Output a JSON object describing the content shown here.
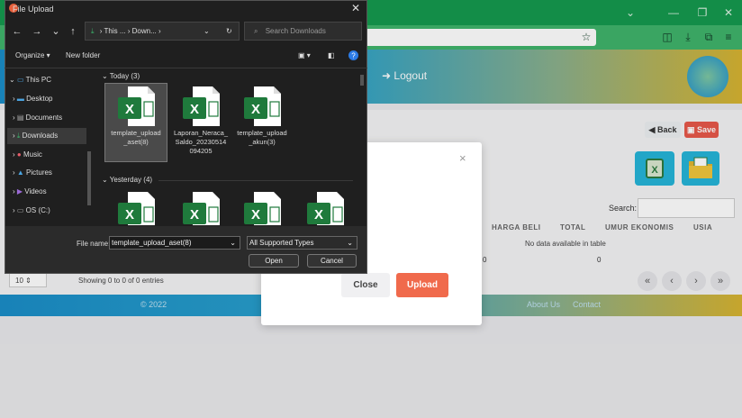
{
  "browser": {
    "minimize_icon": "—",
    "restore_icon": "❐",
    "close_icon": "✕",
    "chevron_icon": "⌄"
  },
  "app": {
    "logout_label": "Logout",
    "back_label": "Back",
    "save_label": "Save",
    "search_label": "Search:",
    "columns": [
      "HARGA BELI",
      "TOTAL",
      "UMUR EKONOMIS",
      "USIA"
    ],
    "no_data": "No data available in table",
    "totals": [
      "0",
      "0"
    ],
    "per_page": "10",
    "showing": "Showing 0 to 0 of 0 entries",
    "pagination": [
      "«",
      "‹",
      "›",
      "»"
    ],
    "footer_left": "© 2022",
    "footer_mid": "About Us",
    "footer_right": "Contact"
  },
  "modal": {
    "close_x": "×",
    "close_label": "Close",
    "upload_label": "Upload"
  },
  "dialog": {
    "title": "File Upload",
    "path": "›  This ...  ›  Down...  ›",
    "search_placeholder": "Search Downloads",
    "organize": "Organize ▾",
    "new_folder": "New folder",
    "sidebar": [
      {
        "label": "This PC",
        "icon": "pc-icon"
      },
      {
        "label": "Desktop",
        "icon": "desktop-icon"
      },
      {
        "label": "Documents",
        "icon": "documents-icon"
      },
      {
        "label": "Downloads",
        "icon": "downloads-icon"
      },
      {
        "label": "Music",
        "icon": "music-icon"
      },
      {
        "label": "Pictures",
        "icon": "pictures-icon"
      },
      {
        "label": "Videos",
        "icon": "videos-icon"
      },
      {
        "label": "OS (C:)",
        "icon": "drive-icon"
      }
    ],
    "group_today": "Today (3)",
    "group_yesterday": "Yesterday (4)",
    "files_today": [
      {
        "line1": "template_upload",
        "line2": "_aset(8)",
        "line3": ""
      },
      {
        "line1": "Laporan_Neraca_",
        "line2": "Saldo_20230514",
        "line3": "094205"
      },
      {
        "line1": "template_upload",
        "line2": "_akun(3)",
        "line3": ""
      }
    ],
    "filename_label": "File name:",
    "filename_value": "template_upload_aset(8)",
    "filetype_value": "All Supported Types",
    "open_label": "Open",
    "cancel_label": "Cancel",
    "excel_color": "#1f7a3c"
  }
}
